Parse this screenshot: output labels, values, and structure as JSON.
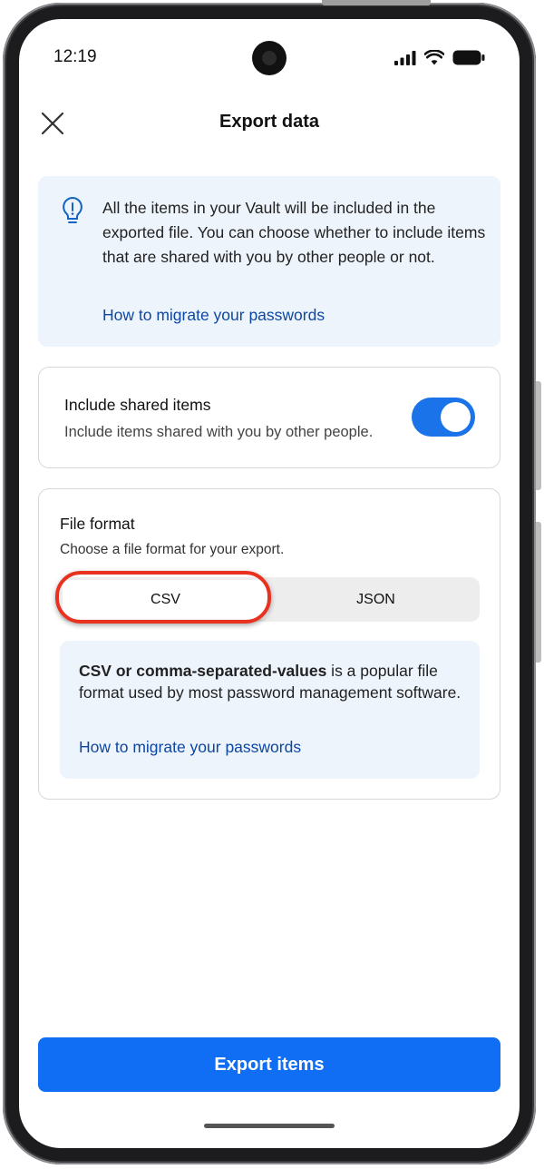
{
  "status_bar": {
    "time": "12:19",
    "icons": [
      "signal-icon",
      "wifi-icon",
      "battery-icon"
    ]
  },
  "header": {
    "title": "Export data",
    "close_icon": "close-icon"
  },
  "info_banner": {
    "icon": "lightbulb-icon",
    "text": "All the items in your Vault will be included in the exported file. You can choose whether to include items that are shared with you by other people or not.",
    "link": "How to migrate your passwords"
  },
  "shared_items": {
    "title": "Include shared items",
    "description": "Include items shared with you by other people.",
    "toggle_on": true
  },
  "file_format": {
    "title": "File format",
    "description": "Choose a file format for your export.",
    "options": [
      "CSV",
      "JSON"
    ],
    "selected": "CSV",
    "info_bold": "CSV or comma-separated-values",
    "info_rest": " is a popular file format used by most password management software.",
    "info_link": "How to migrate your passwords"
  },
  "export_button": {
    "label": "Export items"
  },
  "colors": {
    "accent": "#0f6ef4",
    "toggle": "#1a73e8",
    "link": "#0d47a1",
    "banner_bg": "#eef4fc",
    "highlight": "#e8321f"
  }
}
